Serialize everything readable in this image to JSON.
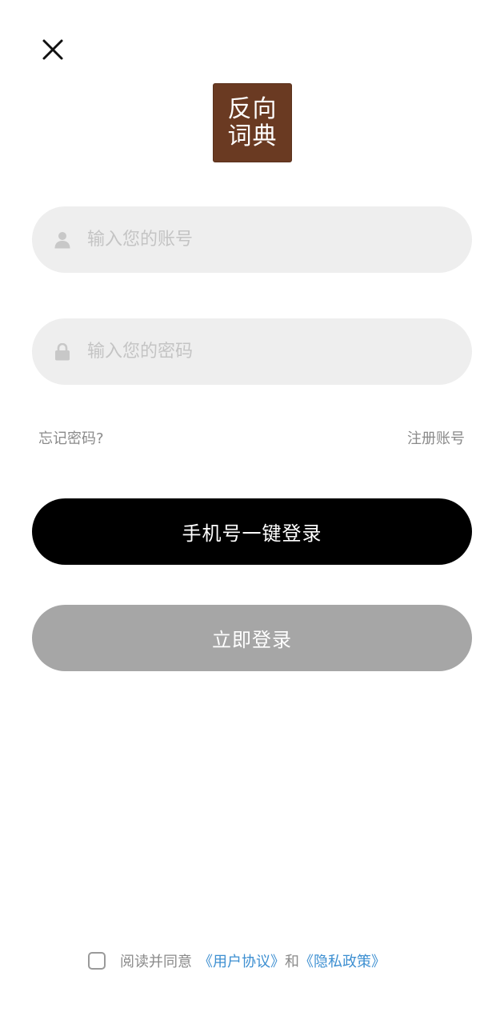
{
  "header": {
    "close_icon": "close-icon",
    "logo_line1": "反向",
    "logo_line2": "词典",
    "logo_color": "#6a3a22"
  },
  "form": {
    "account_placeholder": "输入您的账号",
    "account_value": "",
    "account_icon": "user-icon",
    "password_placeholder": "输入您的密码",
    "password_value": "",
    "password_icon": "lock-icon",
    "forgot_label": "忘记密码?",
    "register_label": "注册账号"
  },
  "actions": {
    "phone_login_label": "手机号一键登录",
    "login_label": "立即登录",
    "phone_login_color": "#000000",
    "login_color": "#a6a6a6"
  },
  "agreement": {
    "checked": false,
    "prefix": "阅读并同意",
    "user_agreement": "《用户协议》",
    "conjunction": "和",
    "privacy_policy": "《隐私政策》",
    "link_color": "#3d8fd1"
  }
}
